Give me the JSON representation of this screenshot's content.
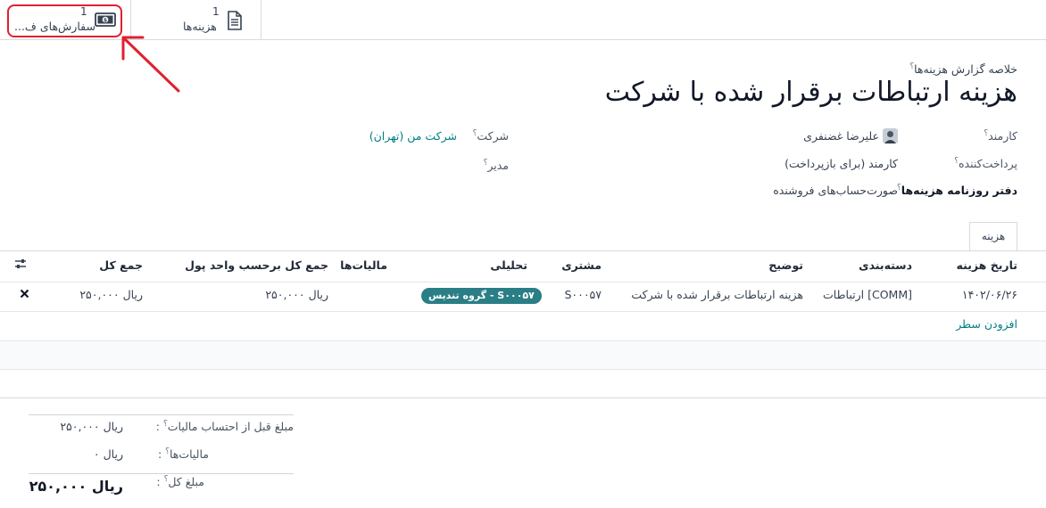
{
  "smart_buttons": {
    "orders": {
      "count": "1",
      "label": "سفارش‌های ف..."
    },
    "expenses": {
      "count": "1",
      "label": "هزینه‌ها"
    }
  },
  "header": {
    "subtitle": "خلاصه گزارش هزینه‌ها",
    "title": "هزینه ارتباطات برقرار شده با شرکت"
  },
  "fields": {
    "employee": {
      "label": "کارمند",
      "value": "علیرضا غضنفری"
    },
    "paid_by": {
      "label": "پرداخت‌کننده",
      "value": "کارمند (برای بازپرداخت)"
    },
    "journal": {
      "label": "دفتر روزنامه هزینه‌ها",
      "value": "صورت‌حساب‌های فروشنده"
    },
    "company": {
      "label": "شرکت",
      "value": "شرکت من (تهران)"
    },
    "manager": {
      "label": "مدیر",
      "value": ""
    }
  },
  "tabs": [
    "هزینه"
  ],
  "table": {
    "columns": [
      "تاریخ هزینه",
      "دسته‌بندی",
      "توضیح",
      "مشتری",
      "تحلیلی",
      "مالیات‌ها",
      "جمع کل برحسب واحد پول",
      "جمع کل"
    ],
    "rows": [
      {
        "date": "۱۴۰۲/۰۶/۲۶",
        "category": "[COMM] ارتباطات",
        "description": "هزینه ارتباطات برقرار شده با شرکت",
        "customer": "S۰۰۰۵۷",
        "analytic": "S۰۰۰۵۷ - گروه تندیس",
        "taxes": "",
        "total_currency": "ریال ۲۵۰,۰۰۰",
        "total": "ریال ۲۵۰,۰۰۰"
      }
    ],
    "add_line": "افزودن سطر"
  },
  "totals": {
    "untaxed": {
      "label": "مبلغ قبل از احتساب مالیات",
      "value": "ریال ۲۵۰,۰۰۰"
    },
    "taxes": {
      "label": "مالیات‌ها",
      "value": "ریال ۰"
    },
    "total": {
      "label": "مبلغ کل",
      "value": "ریال ۲۵۰,۰۰۰"
    }
  },
  "colors": {
    "accent": "#017e84",
    "badge": "#2a7e86",
    "highlight": "#e0202f"
  }
}
